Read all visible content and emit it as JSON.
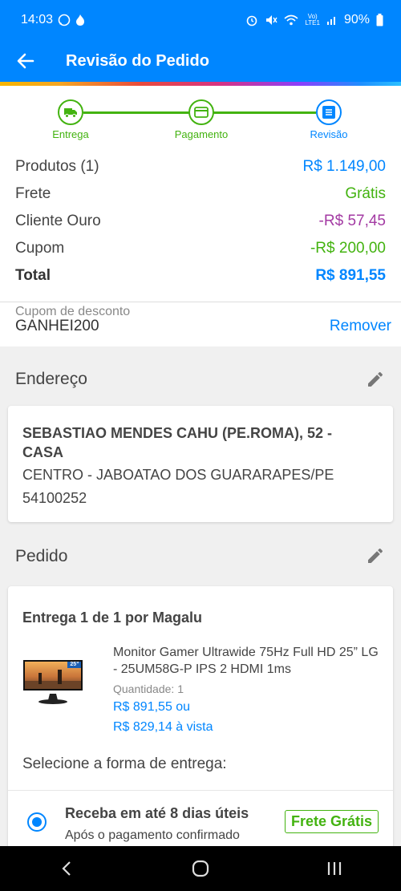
{
  "status_bar": {
    "time": "14:03",
    "battery": "90%"
  },
  "app_bar": {
    "title": "Revisão do Pedido"
  },
  "stepper": {
    "steps": [
      {
        "label": "Entrega",
        "icon": "truck-icon"
      },
      {
        "label": "Pagamento",
        "icon": "card-icon"
      },
      {
        "label": "Revisão",
        "icon": "list-icon"
      }
    ],
    "accent_green": "#43b310",
    "accent_blue": "#0086ff"
  },
  "summary": {
    "rows": [
      {
        "label": "Produtos (1)",
        "value": "R$ 1.149,00",
        "color": "#0086ff"
      },
      {
        "label": "Frete",
        "value": "Grátis",
        "color": "#43b310"
      },
      {
        "label": "Cliente Ouro",
        "value": "-R$ 57,45",
        "color": "#a33aa3"
      },
      {
        "label": "Cupom",
        "value": "-R$ 200,00",
        "color": "#43b310"
      },
      {
        "label": "Total",
        "value": "R$ 891,55",
        "color": "#0086ff"
      }
    ]
  },
  "coupon": {
    "label": "Cupom de desconto",
    "code": "GANHEI200",
    "remove_label": "Remover"
  },
  "address": {
    "section_title": "Endereço",
    "name_line": "SEBASTIAO MENDES CAHU (PE.ROMA), 52 - CASA",
    "city_line": "CENTRO - JABOATAO DOS GUARARAPES/PE",
    "zip_line": "54100252"
  },
  "order": {
    "section_title": "Pedido",
    "delivery_title": "Entrega 1 de 1 por Magalu",
    "product": {
      "name": "Monitor Gamer Ultrawide 75Hz Full HD 25” LG - 25UM58G-P IPS 2 HDMI 1ms",
      "image_badge": "25”",
      "quantity_label": "Quantidade:",
      "quantity": "1",
      "price_installment": "R$ 891,55 ou",
      "price_cash": "R$ 829,14 à vista"
    },
    "shipping_prompt": "Selecione a forma de entrega:",
    "shipping_option": {
      "title": "Receba em até 8 dias úteis",
      "subtitle": "Após o pagamento confirmado",
      "badge": "Frete Grátis"
    }
  }
}
